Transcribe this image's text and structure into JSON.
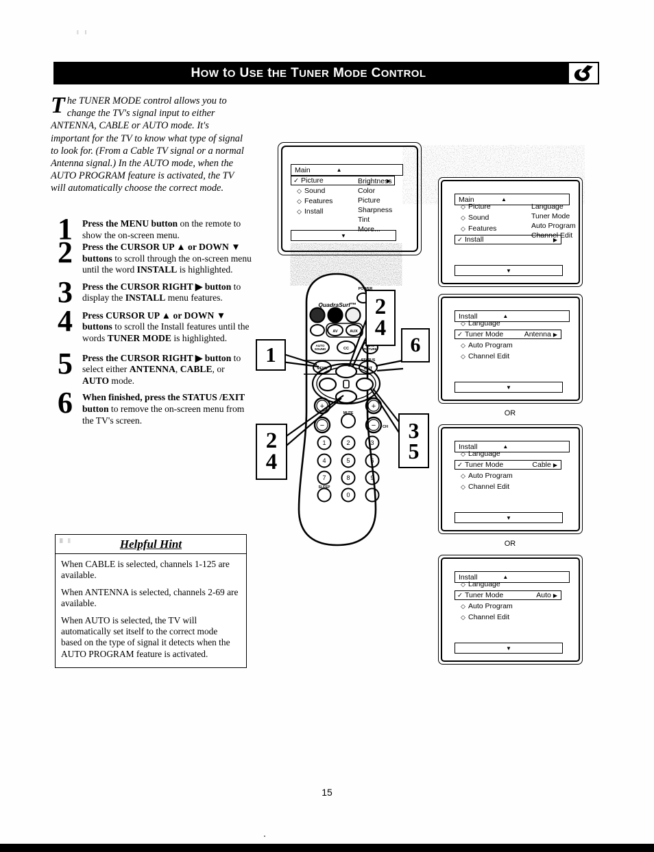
{
  "header": {
    "title": "How to Use the Tuner Mode Control",
    "logo_icon": "philips-swirl-logo-icon"
  },
  "intro": {
    "dropcap": "T",
    "text": "he TUNER MODE control allows you to change the TV's signal input to either ANTENNA, CABLE or AUTO mode. It's important for the TV to know what type of signal to look for. (From a Cable TV signal or a normal Antenna signal.) In the AUTO mode, when the AUTO PROGRAM feature is activated, the TV will automatically choose the correct mode."
  },
  "steps": [
    {
      "num": "1",
      "html": "<b>Press the MENU button</b> on the remote to show the on-screen menu."
    },
    {
      "num": "2",
      "html": "<b>Press the CURSOR UP ▲ or DOWN ▼ buttons</b> to scroll through the on-screen menu until the word <b>INSTALL</b> is highlighted."
    },
    {
      "num": "3",
      "html": "<b>Press the CURSOR RIGHT ▶ button</b> to display the <b>INSTALL</b> menu features."
    },
    {
      "num": "4",
      "html": "<b>Press CURSOR UP ▲ or DOWN ▼ buttons</b> to scroll the Install features until the words <b>TUNER MODE</b> is highlighted."
    },
    {
      "num": "5",
      "html": "<b>Press the CURSOR RIGHT ▶ button</b> to select either <b>ANTENNA</b>, <b>CABLE</b>, or <b>AUTO</b> mode."
    },
    {
      "num": "6",
      "html": "<b>When finished, press the STATUS /EXIT button</b> to remove the on-screen menu from the TV's screen."
    }
  ],
  "hint": {
    "title": "Helpful Hint",
    "paragraphs": [
      "When CABLE is selected, channels 1-125 are available.",
      "When ANTENNA is selected, channels 2-69 are available.",
      "When AUTO is selected, the TV will automatically set itself to the correct mode based on the type of signal it detects when the AUTO PROGRAM feature is activated."
    ]
  },
  "osd_menus": [
    {
      "id": "tv-screen-main-picture",
      "title": "Main",
      "up_arrow": "▲",
      "down_arrow": "▼",
      "rows": [
        {
          "label": "Picture",
          "marker": "✓",
          "selected": true,
          "arrow": "▶",
          "value": ""
        },
        {
          "label": "Sound",
          "marker": "◇",
          "selected": false,
          "arrow": "",
          "value": ""
        },
        {
          "label": "Features",
          "marker": "◇",
          "selected": false,
          "arrow": "",
          "value": ""
        },
        {
          "label": "Install",
          "marker": "◇",
          "selected": false,
          "arrow": "",
          "value": ""
        }
      ],
      "submenu": [
        "Brightness",
        "Color",
        "Picture",
        "Sharpness",
        "Tint",
        "More..."
      ]
    },
    {
      "id": "menu-main-install",
      "title": "Main",
      "up_arrow": "▲",
      "down_arrow": "▼",
      "rows": [
        {
          "label": "Picture",
          "marker": "◇",
          "selected": false,
          "arrow": "",
          "value": ""
        },
        {
          "label": "Sound",
          "marker": "◇",
          "selected": false,
          "arrow": "",
          "value": ""
        },
        {
          "label": "Features",
          "marker": "◇",
          "selected": false,
          "arrow": "",
          "value": ""
        },
        {
          "label": "Install",
          "marker": "✓",
          "selected": true,
          "arrow": "▶",
          "value": ""
        }
      ],
      "submenu": [
        "Language",
        "Tuner Mode",
        "Auto Program",
        "Channel Edit"
      ]
    },
    {
      "id": "menu-install-antenna",
      "title": "Install",
      "up_arrow": "▲",
      "down_arrow": "▼",
      "rows": [
        {
          "label": "Language",
          "marker": "◇",
          "selected": false,
          "arrow": "",
          "value": ""
        },
        {
          "label": "Tuner Mode",
          "marker": "✓",
          "selected": true,
          "arrow": "▶",
          "value": "Antenna"
        },
        {
          "label": "Auto Program",
          "marker": "◇",
          "selected": false,
          "arrow": "",
          "value": ""
        },
        {
          "label": "Channel Edit",
          "marker": "◇",
          "selected": false,
          "arrow": "",
          "value": ""
        }
      ],
      "submenu": []
    },
    {
      "id": "menu-install-cable",
      "title": "Install",
      "up_arrow": "▲",
      "down_arrow": "▼",
      "rows": [
        {
          "label": "Language",
          "marker": "◇",
          "selected": false,
          "arrow": "",
          "value": ""
        },
        {
          "label": "Tuner Mode",
          "marker": "✓",
          "selected": true,
          "arrow": "▶",
          "value": "Cable"
        },
        {
          "label": "Auto Program",
          "marker": "◇",
          "selected": false,
          "arrow": "",
          "value": ""
        },
        {
          "label": "Channel Edit",
          "marker": "◇",
          "selected": false,
          "arrow": "",
          "value": ""
        }
      ],
      "submenu": []
    },
    {
      "id": "menu-install-auto",
      "title": "Install",
      "up_arrow": "▲",
      "down_arrow": "▼",
      "rows": [
        {
          "label": "Language",
          "marker": "◇",
          "selected": false,
          "arrow": "",
          "value": ""
        },
        {
          "label": "Tuner Mode",
          "marker": "✓",
          "selected": true,
          "arrow": "▶",
          "value": "Auto"
        },
        {
          "label": "Auto Program",
          "marker": "◇",
          "selected": false,
          "arrow": "",
          "value": ""
        },
        {
          "label": "Channel Edit",
          "marker": "◇",
          "selected": false,
          "arrow": "",
          "value": ""
        }
      ],
      "submenu": []
    }
  ],
  "or_labels": {
    "first": "OR",
    "second": "OR"
  },
  "callouts": {
    "left_top": "1",
    "left_mid_a": "2",
    "left_mid_b": "4",
    "remote_top_a": "2",
    "remote_top_b": "4",
    "right_six": "6",
    "right_three": "3",
    "right_five": "5"
  },
  "remote": {
    "brand": "QuadraSurf™",
    "labels": {
      "power": "POWER",
      "av": "AV",
      "aux": "AUX",
      "auto_sound": "AUTO SOUND",
      "cc": "CC",
      "auto_picture": "AUTO PICTURE",
      "menu": "MENU",
      "status": "STATUS",
      "exit": "EXIT",
      "mute": "MUTE",
      "ch": "CH",
      "sleep": "SLEEP"
    },
    "keypad": [
      "1",
      "2",
      "3",
      "4",
      "5",
      "6",
      "7",
      "8",
      "9",
      "0"
    ]
  },
  "footer": {
    "page_number": "15"
  }
}
